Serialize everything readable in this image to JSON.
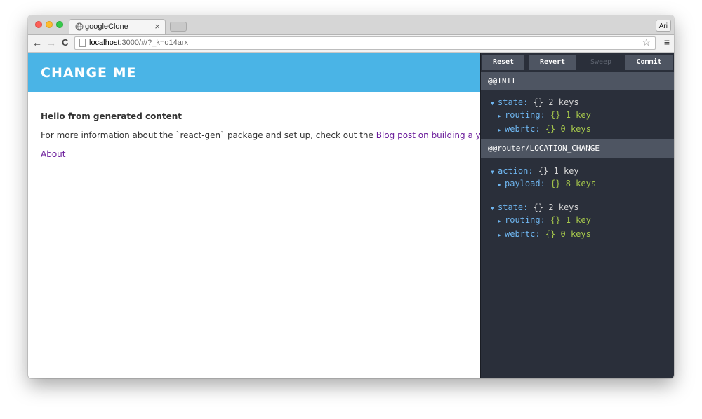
{
  "browser": {
    "tab_title": "googleClone",
    "tab_close": "×",
    "profile": "Ari",
    "url_host": "localhost",
    "url_path": ":3000/#/?_k=o14arx",
    "back": "←",
    "forward": "→",
    "reload": "C",
    "star": "☆",
    "menu": "≡"
  },
  "app": {
    "header_title": "CHANGE ME",
    "hello": "Hello from generated content",
    "info_text": "For more information about the `react-gen` package and set up, check out the ",
    "info_link": "Blog post on building a yelp clone with",
    "about_link": "About"
  },
  "devtools": {
    "buttons": {
      "reset": "Reset",
      "revert": "Revert",
      "sweep": "Sweep",
      "commit": "Commit"
    },
    "actions": [
      {
        "name": "@@INIT",
        "tree": [
          {
            "key": "state:",
            "braces": "{}",
            "count": "2 keys"
          },
          {
            "key": "routing:",
            "braces": "{}",
            "count": "1 key"
          },
          {
            "key": "webrtc:",
            "braces": "{}",
            "count": "0 keys"
          }
        ]
      },
      {
        "name": "@@router/LOCATION_CHANGE",
        "tree": [
          {
            "key": "action:",
            "braces": "{}",
            "count": "1 key"
          },
          {
            "key": "payload:",
            "braces": "{}",
            "count": "8 keys"
          },
          {
            "key": "state:",
            "braces": "{}",
            "count": "2 keys"
          },
          {
            "key": "routing:",
            "braces": "{}",
            "count": "1 key"
          },
          {
            "key": "webrtc:",
            "braces": "{}",
            "count": "0 keys"
          }
        ]
      }
    ]
  },
  "colors": {
    "header_bg": "#4ab4e6",
    "devtools_bg": "#2a2f3a",
    "key": "#6fb6f0",
    "value": "#a6c84c",
    "link": "#6a1b9a"
  }
}
